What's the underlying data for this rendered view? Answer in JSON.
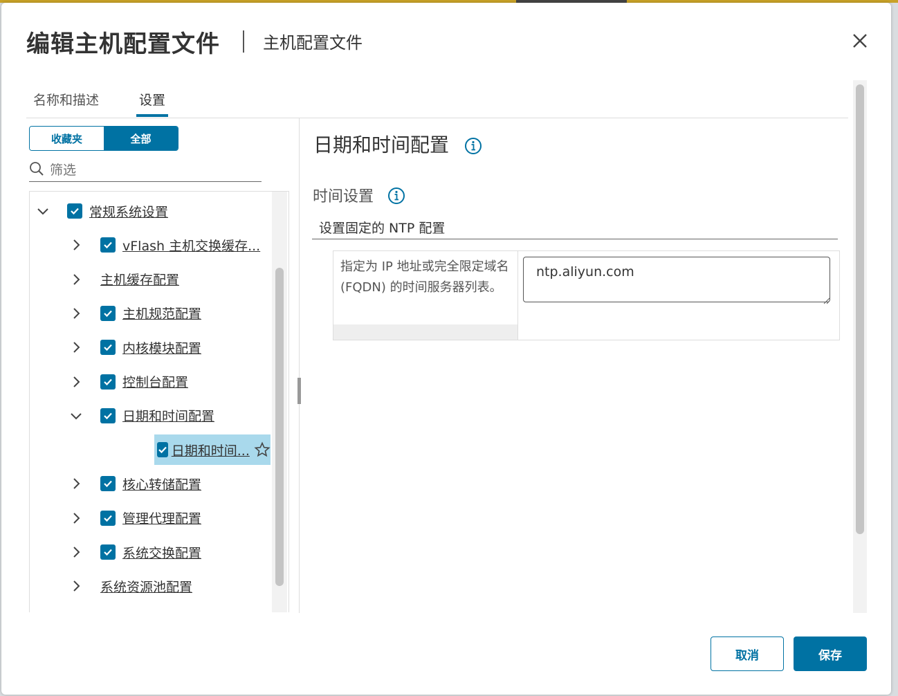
{
  "dialog": {
    "title": "编辑主机配置文件",
    "subtitle": "主机配置文件",
    "tabs": [
      {
        "label": "名称和描述",
        "active": false
      },
      {
        "label": "设置",
        "active": true
      }
    ]
  },
  "left": {
    "segment": {
      "favorites": "收藏夹",
      "all": "全部",
      "selected": "全部"
    },
    "filter_placeholder": "筛选",
    "tree": [
      {
        "label": "常规系统设置",
        "checked": true,
        "expanded": true,
        "level": 0
      },
      {
        "label": "vFlash 主机交换缓存...",
        "checked": true,
        "expanded": false,
        "level": 1
      },
      {
        "label": "主机缓存配置",
        "checked": false,
        "expanded": false,
        "level": 1
      },
      {
        "label": "主机规范配置",
        "checked": true,
        "expanded": false,
        "level": 1
      },
      {
        "label": "内核模块配置",
        "checked": true,
        "expanded": false,
        "level": 1
      },
      {
        "label": "控制台配置",
        "checked": true,
        "expanded": false,
        "level": 1
      },
      {
        "label": "日期和时间配置",
        "checked": true,
        "expanded": true,
        "level": 1
      },
      {
        "label": "日期和时间...",
        "checked": true,
        "level": 2,
        "selected": true
      },
      {
        "label": "核心转储配置",
        "checked": true,
        "expanded": false,
        "level": 1
      },
      {
        "label": "管理代理配置",
        "checked": true,
        "expanded": false,
        "level": 1
      },
      {
        "label": "系统交换配置",
        "checked": true,
        "expanded": false,
        "level": 1
      },
      {
        "label": "系统资源池配置",
        "checked": false,
        "expanded": false,
        "level": 1
      }
    ]
  },
  "right": {
    "title": "日期和时间配置",
    "time_settings_label": "时间设置",
    "section_label": "设置固定的 NTP 配置",
    "field_description": "指定为 IP 地址或完全限定域名 (FQDN) 的时间服务器列表。",
    "ntp_value": "ntp.aliyun.com"
  },
  "footer": {
    "cancel": "取消",
    "save": "保存"
  },
  "colors": {
    "accent": "#0072a3",
    "selected_row": "#a9d9ec"
  }
}
